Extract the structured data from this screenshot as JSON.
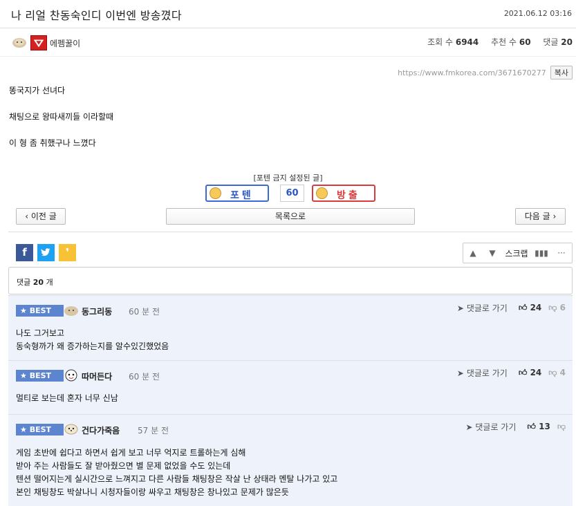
{
  "post": {
    "title": "나 리얼 찬동숙인디 이번엔 방송꼈다",
    "date": "2021.06.12 03:16",
    "author": "에펨꿀이",
    "views_label": "조회 수",
    "views": "6944",
    "recommend_label": "추천 수",
    "recommend": "60",
    "comments_label": "댓글",
    "comments": "20",
    "url": "https://www.fmkorea.com/3671670277",
    "copy_label": "복사",
    "lines": [
      "똥국지가 선녀다",
      "채팅으로 왕따새끼들 이라할때",
      "이 형 좀 취했구나 느꼈다"
    ]
  },
  "vote": {
    "note": "[포텐 금지 설정된 글]",
    "up_label": "포텐",
    "count": "60",
    "down_label": "방출"
  },
  "nav": {
    "prev": "이전 글",
    "list": "목록으로",
    "next": "다음 글"
  },
  "toolbar": {
    "scrap": "스크랩"
  },
  "comments_header": {
    "label": "댓글",
    "count": "20",
    "suffix": "개"
  },
  "comments": [
    {
      "badge": "BEST",
      "name": "동그리동",
      "time": "60 분 전",
      "reply": "댓글로 가기",
      "up": "24",
      "down": "6",
      "lines": [
        "나도 그거보고",
        "동숙형까가 왜 증가하는지를 알수있긴했었음"
      ]
    },
    {
      "badge": "BEST",
      "name": "따머든다",
      "time": "60 분 전",
      "reply": "댓글로 가기",
      "up": "24",
      "down": "4",
      "lines": [
        "멀티로 보는데 혼자 너무 신남"
      ]
    },
    {
      "badge": "BEST",
      "name": "건다가죽음",
      "time": "57 분 전",
      "reply": "댓글로 가기",
      "up": "13",
      "down": "",
      "lines": [
        "게임 초반에 쉽다고 하면서 쉽게 보고 너무 억지로 트롤하는게 심해",
        "받아 주는 사람들도 잘 받아줬으면 별 문제 없었을 수도 있는데",
        "텐션 떨어지는게 실시간으로 느껴지고 다른 사람들 채팅창은 작살 난 상태라 멘탈 나가고 있고",
        "본인 채팅창도 박살나니 시청자들이랑 싸우고 채팅창은 창나있고 문제가 많은듯"
      ]
    }
  ]
}
